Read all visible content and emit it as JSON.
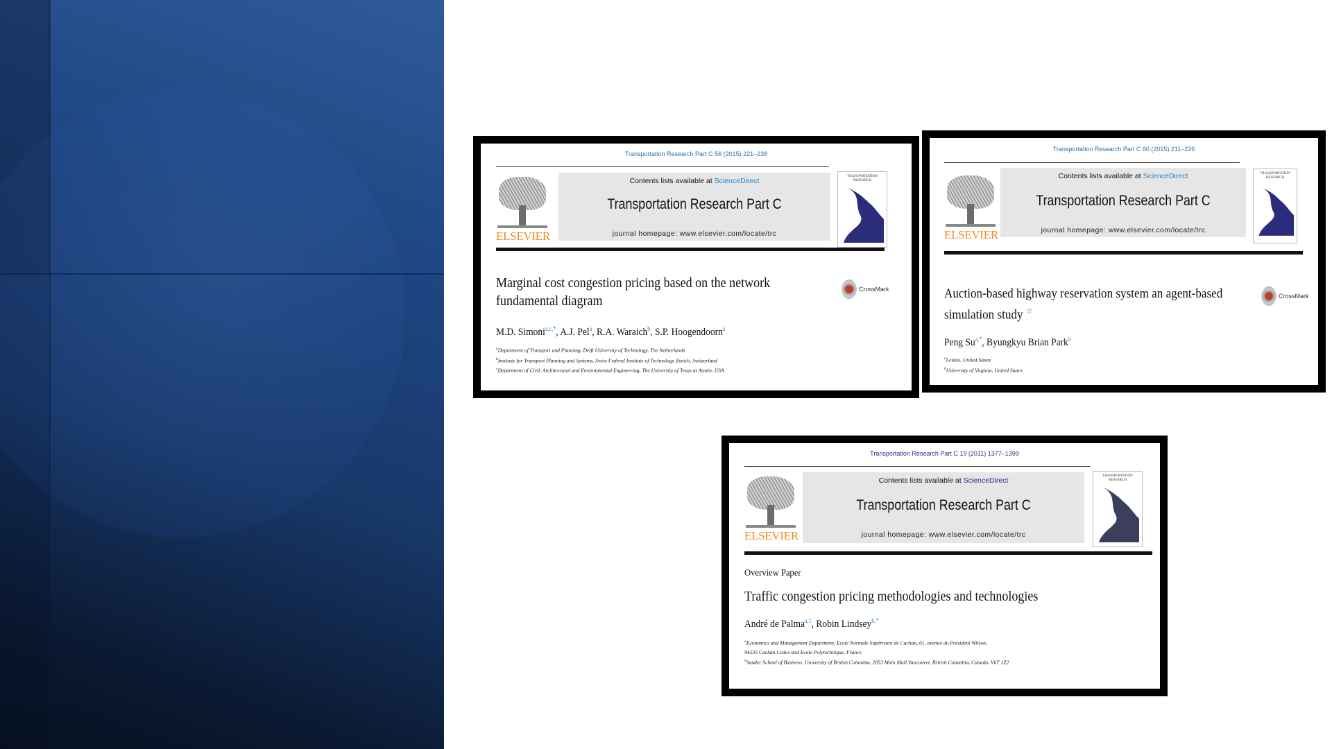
{
  "papers": [
    {
      "citation": "Transportation Research Part C 56 (2015) 221–238",
      "contents_prefix": "Contents lists available at ",
      "contents_link": "ScienceDirect",
      "journal": "Transportation Research Part C",
      "homepage": "journal homepage: www.elsevier.com/locate/trc",
      "publisher": "ELSEVIER",
      "cover_text": "TRANSPORTATION RESEARCH",
      "crossmark": "CrossMark",
      "title_line1": "Marginal cost congestion pricing based on the network",
      "title_line2": "fundamental diagram",
      "authors": [
        {
          "name": "M.D. Simoni",
          "sup": "a,c,*"
        },
        {
          "name": "A.J. Pel",
          "sup": "a"
        },
        {
          "name": "R.A. Waraich",
          "sup": "b"
        },
        {
          "name": "S.P. Hoogendoorn",
          "sup": "a"
        }
      ],
      "affiliations": [
        {
          "sup": "a",
          "text": "Department of Transport and Planning, Delft University of Technology, The Netherlands"
        },
        {
          "sup": "b",
          "text": "Institute for Transport Planning and Systems, Swiss Federal Institute of Technology Zurich, Switzerland"
        },
        {
          "sup": "c",
          "text": "Department of Civil, Architectural and Environmental Engineering, The University of Texas at Austin, USA"
        }
      ]
    },
    {
      "citation": "Transportation Research Part C 60 (2015) 211–226",
      "contents_prefix": "Contents lists available at ",
      "contents_link": "ScienceDirect",
      "journal": "Transportation Research Part C",
      "homepage": "journal homepage: www.elsevier.com/locate/trc",
      "publisher": "ELSEVIER",
      "cover_text": "TRANSPORTATION RESEARCH",
      "crossmark": "CrossMark",
      "title_line1": "Auction-based highway reservation system an agent-based",
      "title_line2": "simulation study",
      "title_mark": "☆",
      "authors": [
        {
          "name": "Peng Su",
          "sup": "a,*"
        },
        {
          "name": "Byungkyu Brian Park",
          "sup": "b"
        }
      ],
      "affiliations": [
        {
          "sup": "a",
          "text": "Leidos, United States"
        },
        {
          "sup": "b",
          "text": "University of Virginia, United States"
        }
      ]
    },
    {
      "citation": "Transportation Research Part C 19 (2011) 1377–1399",
      "contents_prefix": "Contents lists available at ",
      "contents_link": "ScienceDirect",
      "journal": "Transportation Research Part C",
      "homepage": "journal homepage: www.elsevier.com/locate/trc",
      "publisher": "ELSEVIER",
      "cover_text": "TRANSPORTATION RESEARCH",
      "overview": "Overview Paper",
      "title_line1": "Traffic congestion pricing methodologies and technologies",
      "authors": [
        {
          "name": "André de Palma",
          "sup": "a,1"
        },
        {
          "name": "Robin Lindsey",
          "sup": "b,*"
        }
      ],
      "affiliations": [
        {
          "sup": "a",
          "text": "Economics and Management Department, Ecole Normale Supérieure de Cachan, 61, avenue du Président Wilson,"
        },
        {
          "sup": "",
          "text": "94235 Cachan Cedex and Ecole Polytechnique, France"
        },
        {
          "sup": "b",
          "text": "Sauder School of Business, University of British Columbia, 2053 Main Mall,Vancouver, British Columbia, Canada, V6T 1Z2"
        }
      ]
    }
  ],
  "colors": {
    "publisher_orange": "#f08a1c",
    "link_blue": "#2a7fc0",
    "panel_blue": "#1f4683",
    "cover_navy": "#2b2d7a"
  }
}
